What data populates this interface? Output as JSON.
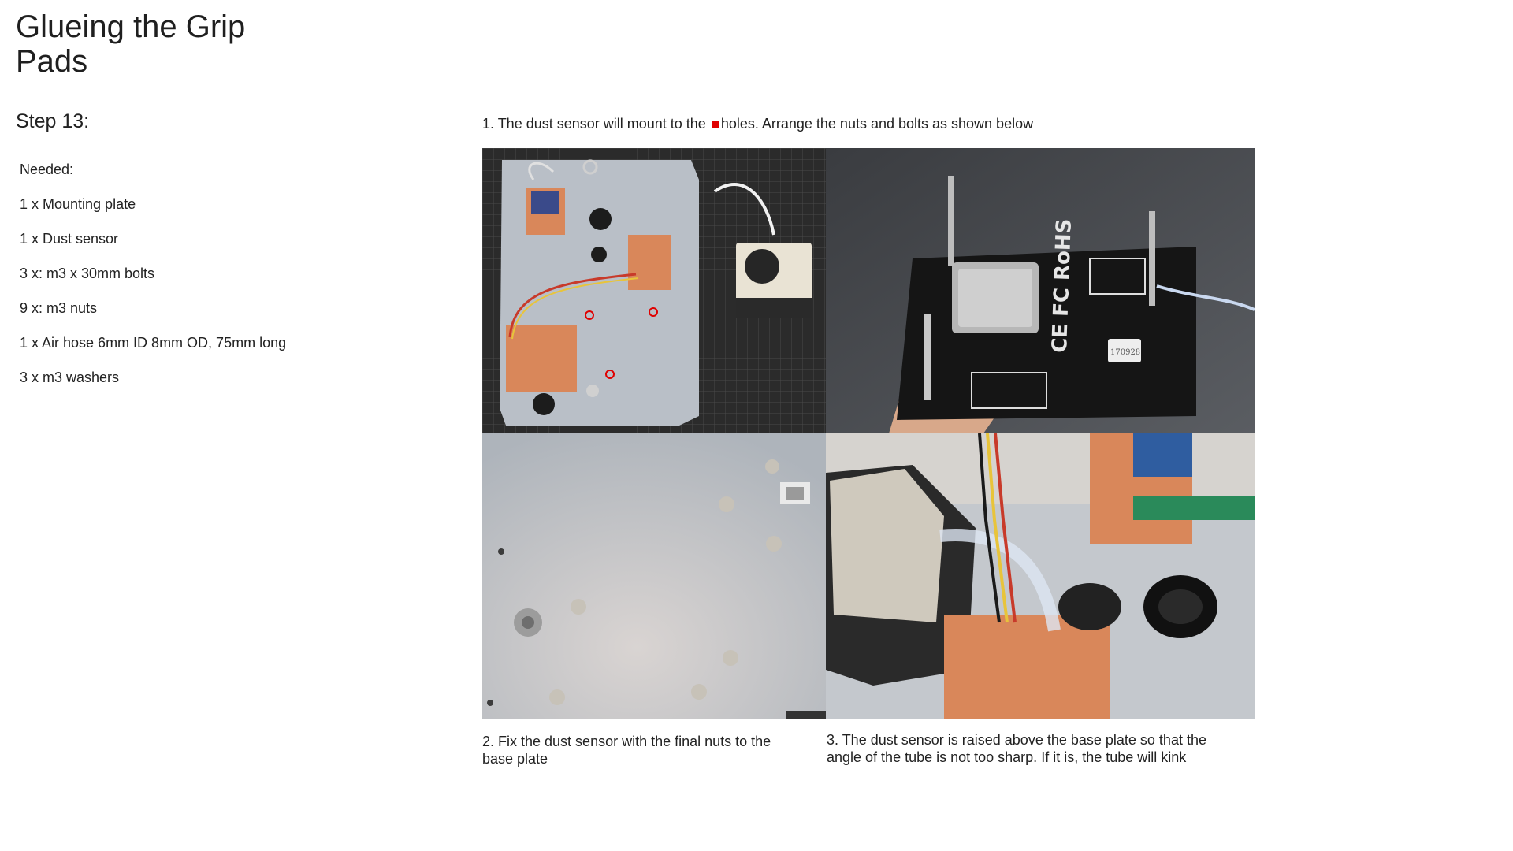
{
  "page": {
    "title": "Glueing the Grip Pads",
    "step": "Step 13:"
  },
  "needed": {
    "heading": "Needed:",
    "items": [
      "1 x Mounting plate",
      "1 x Dust sensor",
      "3 x: m3 x 30mm bolts",
      "9 x: m3 nuts",
      "1 x Air hose 6mm ID 8mm OD, 75mm long",
      "3 x m3 washers"
    ]
  },
  "captions": {
    "top_before": "1. The dust sensor will mount to the",
    "top_after": "holes. Arrange the nuts and bolts as shown below",
    "bottom_left": "2. Fix the dust sensor with the final nuts to the base plate",
    "bottom_right": "3. The dust sensor is raised above the base plate so that the angle of the tube is not too sharp. If it is, the tube will kink"
  },
  "photo_text": {
    "sensor_marks": "CE FC RoHS",
    "sensor_label": "170928"
  },
  "colors": {
    "marker_red": "#e00000",
    "pcb_copper": "#d9875a",
    "cutting_mat": "#2a2a2a",
    "plate_grey": "#b9bfc7"
  }
}
